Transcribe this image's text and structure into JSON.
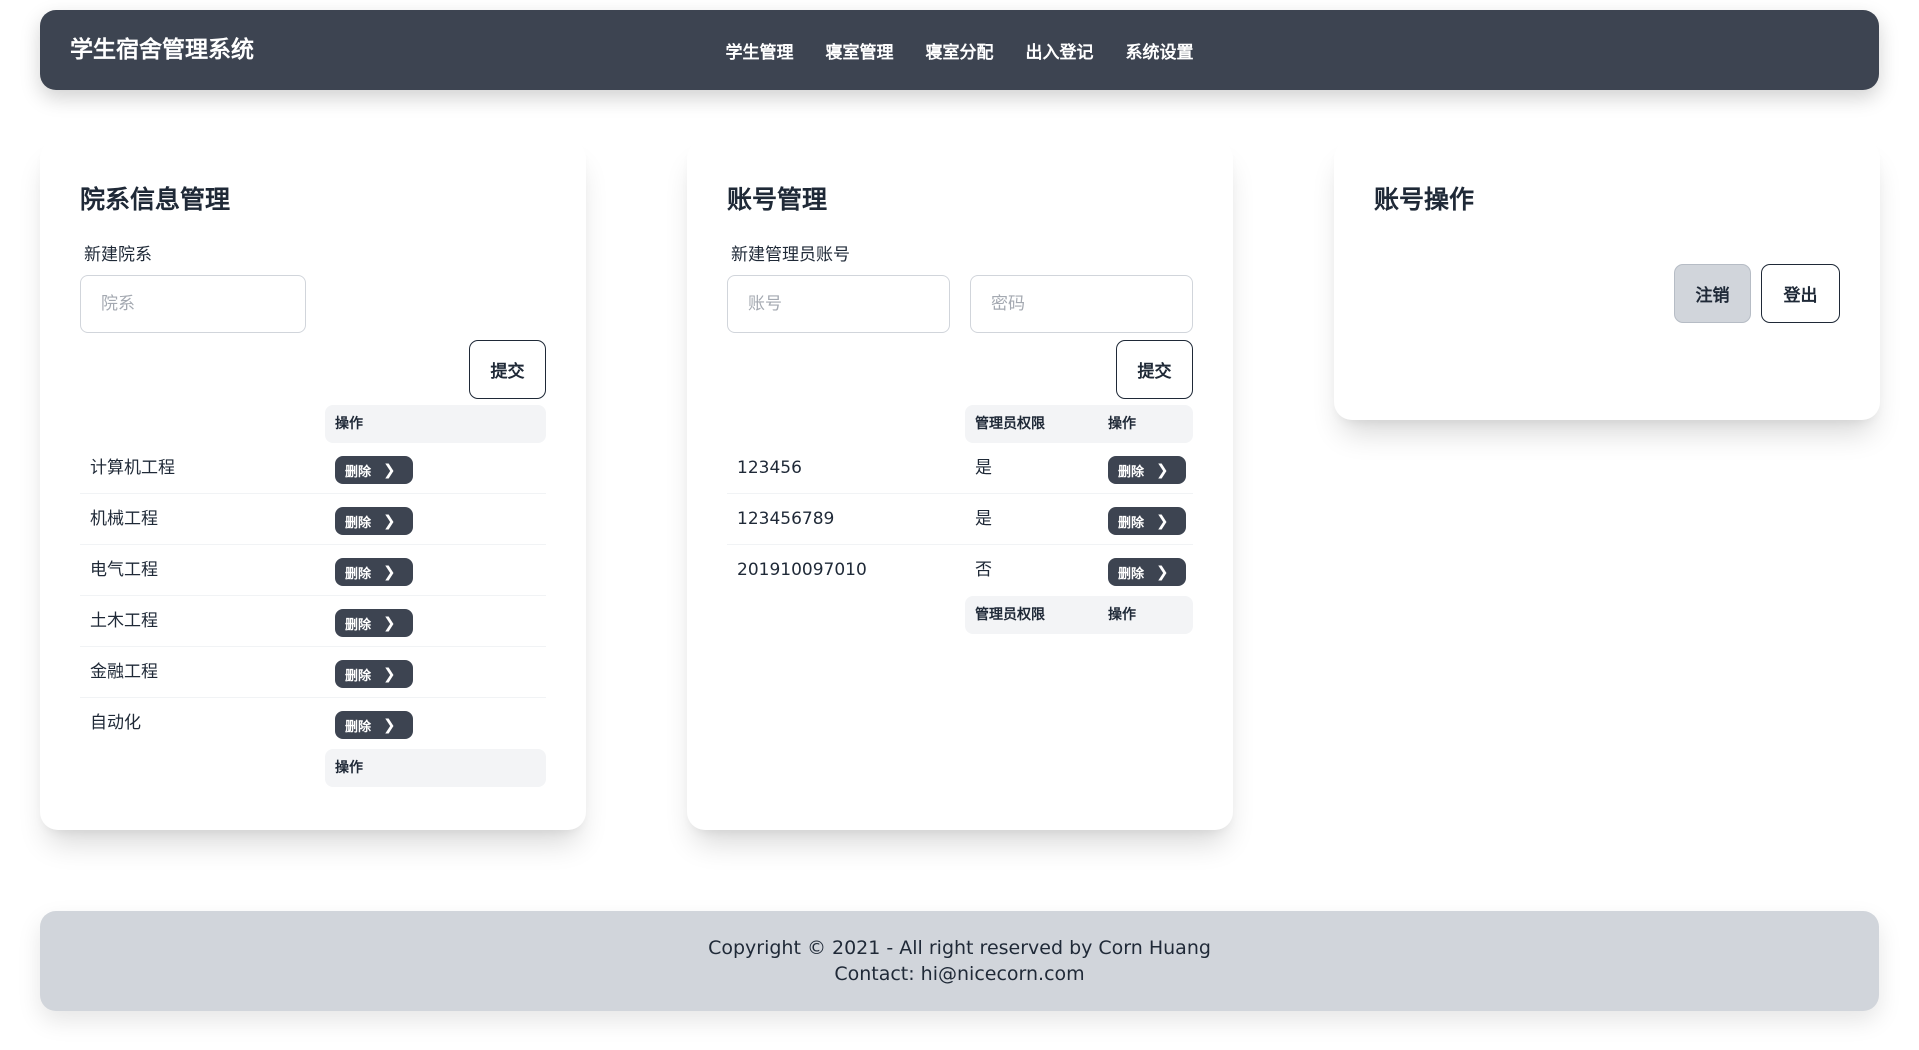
{
  "navbar": {
    "brand": "学生宿舍管理系统",
    "menu": [
      "学生管理",
      "寝室管理",
      "寝室分配",
      "出入登记",
      "系统设置"
    ]
  },
  "dept_card": {
    "title": "院系信息管理",
    "field_label": "新建院系",
    "input_placeholder": "院系",
    "submit_label": "提交",
    "columns": [
      "",
      "操作"
    ],
    "rows": [
      "计算机工程",
      "机械工程",
      "电气工程",
      "土木工程",
      "金融工程",
      "自动化"
    ],
    "delete_label": "删除"
  },
  "acct_card": {
    "title": "账号管理",
    "field_label": "新建管理员账号",
    "account_placeholder": "账号",
    "password_placeholder": "密码",
    "submit_label": "提交",
    "columns": [
      "",
      "管理员权限",
      "操作"
    ],
    "rows": [
      {
        "account": "123456",
        "is_admin": "是"
      },
      {
        "account": "123456789",
        "is_admin": "是"
      },
      {
        "account": "201910097010",
        "is_admin": "否"
      }
    ],
    "delete_label": "删除"
  },
  "ops_card": {
    "title": "账号操作",
    "logoff_label": "注销",
    "logout_label": "登出"
  },
  "footer": {
    "copyright": "Copyright © 2021 - All right reserved by Corn Huang",
    "contact": "Contact: hi@nicecorn.com"
  },
  "colors": {
    "navbar_bg": "#3d4451",
    "footer_bg": "#d1d5db",
    "button_dark": "#3d4451",
    "text": "#1f2937"
  },
  "icons": {
    "delete_chevron": "chevron-right-icon"
  }
}
